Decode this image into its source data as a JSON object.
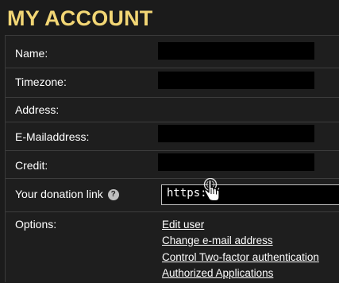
{
  "page": {
    "title": "MY ACCOUNT"
  },
  "account": {
    "rows": [
      {
        "label": "Name:"
      },
      {
        "label": "Timezone:"
      },
      {
        "label": "Address:"
      },
      {
        "label": "E-Mailaddress:"
      },
      {
        "label": "Credit:"
      }
    ],
    "donation": {
      "label": "Your donation link",
      "value": "https://"
    },
    "options": {
      "label": "Options:",
      "links": [
        "Edit user",
        "Change e-mail address",
        "Control Two-factor authentication",
        "Authorized Applications"
      ]
    }
  },
  "icons": {
    "help": "question-circle-icon",
    "cursor": "hand-pointer-cursor-icon"
  }
}
